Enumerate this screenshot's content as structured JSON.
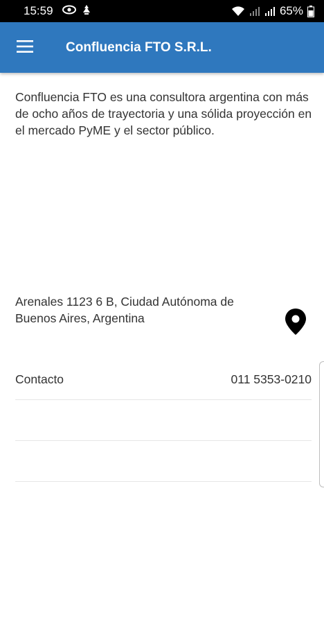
{
  "status_bar": {
    "time": "15:59",
    "battery": "65%",
    "left_icons": [
      "eye-icon",
      "notification-icon"
    ],
    "right_icons": [
      "wifi-icon",
      "signal-icon",
      "signal-icon",
      "battery-icon"
    ]
  },
  "app_bar": {
    "title": "Confluencia FTO S.R.L.",
    "menu_icon": "hamburger-menu-icon",
    "color": "#2f78be"
  },
  "description": "Confluencia FTO es una consultora argentina con más de ocho años de trayectoria y una sólida proyección en el mercado PyME y el sector público.",
  "address": {
    "text": "Arenales 1123 6 B, Ciudad Autónoma de Buenos Aires, Argentina",
    "icon": "map-pin-icon"
  },
  "contact_list": [
    {
      "label": "Contacto",
      "value": "011 5353-0210"
    },
    {
      "label": "",
      "value": ""
    },
    {
      "label": "",
      "value": ""
    }
  ]
}
